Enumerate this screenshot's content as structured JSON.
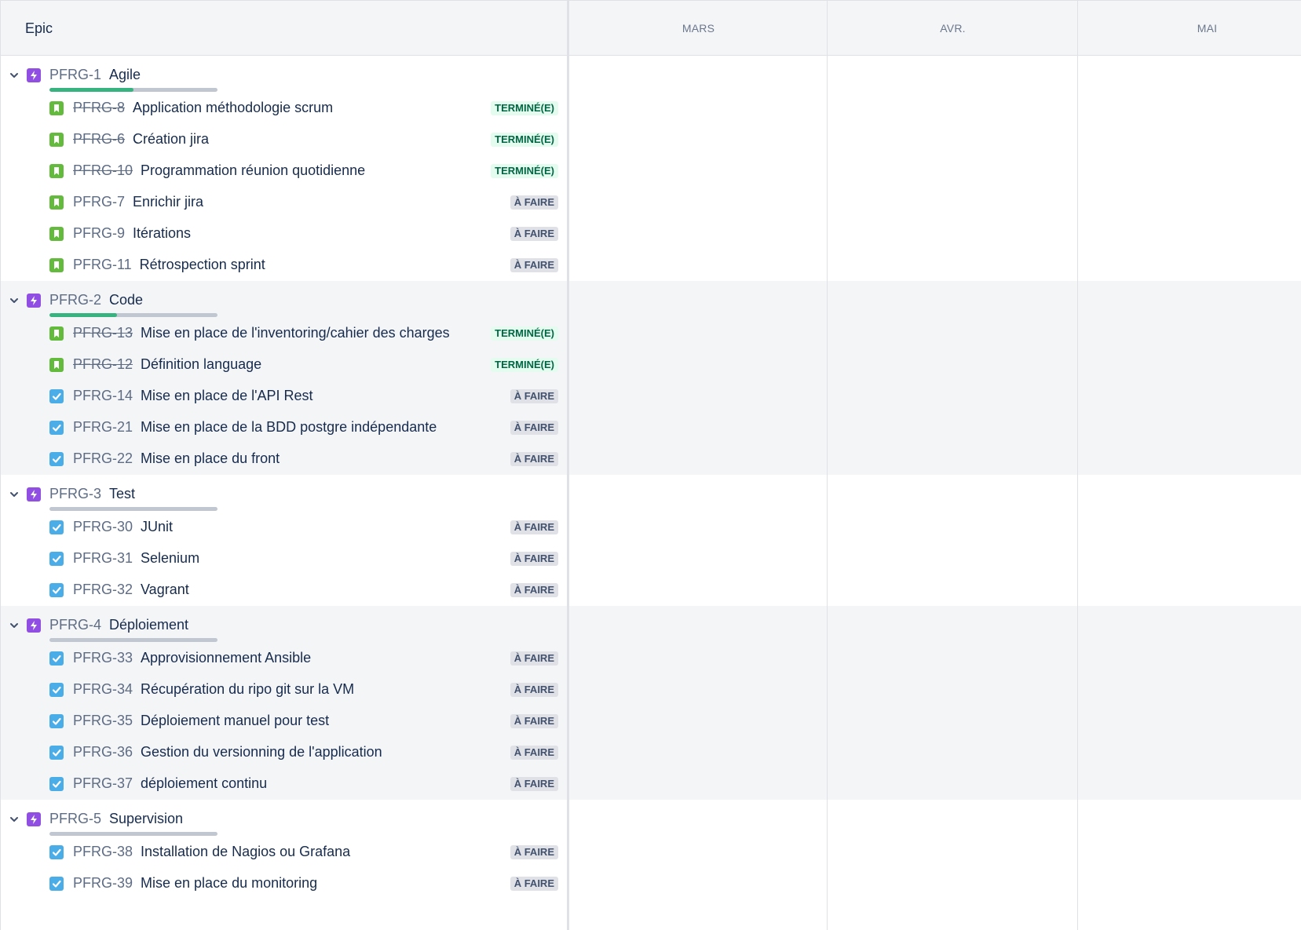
{
  "header": {
    "epic_label": "Epic",
    "months": [
      "MARS",
      "AVR.",
      "MAI"
    ]
  },
  "colors": {
    "epic_icon": "#904ee2",
    "story_icon": "#63ba3c",
    "task_icon": "#4bade8",
    "done_badge_bg": "#e3fcef",
    "done_badge_text": "#006644",
    "todo_badge_bg": "#dfe1e6",
    "todo_badge_text": "#42526e",
    "progress_done": "#36b37e"
  },
  "epics": [
    {
      "key": "PFRG-1",
      "summary": "Agile",
      "progress_done_fraction": 0.5,
      "issues": [
        {
          "key": "PFRG-8",
          "summary": "Application méthodologie scrum",
          "type": "story-icon",
          "status": "TERMINÉ(E)",
          "done": true
        },
        {
          "key": "PFRG-6",
          "summary": "Création jira",
          "type": "story-icon",
          "status": "TERMINÉ(E)",
          "done": true
        },
        {
          "key": "PFRG-10",
          "summary": "Programmation réunion quotidienne",
          "type": "story-icon",
          "status": "TERMINÉ(E)",
          "done": true
        },
        {
          "key": "PFRG-7",
          "summary": "Enrichir jira",
          "type": "story-icon",
          "status": "À FAIRE",
          "done": false
        },
        {
          "key": "PFRG-9",
          "summary": "Itérations",
          "type": "story-icon",
          "status": "À FAIRE",
          "done": false
        },
        {
          "key": "PFRG-11",
          "summary": "Rétrospection sprint",
          "type": "story-icon",
          "status": "À FAIRE",
          "done": false
        }
      ]
    },
    {
      "key": "PFRG-2",
      "summary": "Code",
      "progress_done_fraction": 0.4,
      "issues": [
        {
          "key": "PFRG-13",
          "summary": "Mise en place de l'inventoring/cahier des charges",
          "type": "story-icon",
          "status": "TERMINÉ(E)",
          "done": true
        },
        {
          "key": "PFRG-12",
          "summary": "Définition language",
          "type": "story-icon",
          "status": "TERMINÉ(E)",
          "done": true
        },
        {
          "key": "PFRG-14",
          "summary": "Mise en place de l'API Rest",
          "type": "task-icon",
          "status": "À FAIRE",
          "done": false
        },
        {
          "key": "PFRG-21",
          "summary": "Mise en place de la BDD postgre indépendante",
          "type": "task-icon",
          "status": "À FAIRE",
          "done": false
        },
        {
          "key": "PFRG-22",
          "summary": "Mise en place du front",
          "type": "task-icon",
          "status": "À FAIRE",
          "done": false
        }
      ]
    },
    {
      "key": "PFRG-3",
      "summary": "Test",
      "progress_done_fraction": 0,
      "issues": [
        {
          "key": "PFRG-30",
          "summary": "JUnit",
          "type": "task-icon",
          "status": "À FAIRE",
          "done": false
        },
        {
          "key": "PFRG-31",
          "summary": "Selenium",
          "type": "task-icon",
          "status": "À FAIRE",
          "done": false
        },
        {
          "key": "PFRG-32",
          "summary": "Vagrant",
          "type": "task-icon",
          "status": "À FAIRE",
          "done": false
        }
      ]
    },
    {
      "key": "PFRG-4",
      "summary": "Déploiement",
      "progress_done_fraction": 0,
      "issues": [
        {
          "key": "PFRG-33",
          "summary": "Approvisionnement Ansible",
          "type": "task-icon",
          "status": "À FAIRE",
          "done": false
        },
        {
          "key": "PFRG-34",
          "summary": "Récupération du ripo git sur la VM",
          "type": "task-icon",
          "status": "À FAIRE",
          "done": false
        },
        {
          "key": "PFRG-35",
          "summary": "Déploiement manuel pour test",
          "type": "task-icon",
          "status": "À FAIRE",
          "done": false
        },
        {
          "key": "PFRG-36",
          "summary": "Gestion du versionning de l'application",
          "type": "task-icon",
          "status": "À FAIRE",
          "done": false
        },
        {
          "key": "PFRG-37",
          "summary": "déploiement continu",
          "type": "task-icon",
          "status": "À FAIRE",
          "done": false
        }
      ]
    },
    {
      "key": "PFRG-5",
      "summary": "Supervision",
      "progress_done_fraction": 0,
      "issues": [
        {
          "key": "PFRG-38",
          "summary": "Installation de Nagios ou Grafana",
          "type": "task-icon",
          "status": "À FAIRE",
          "done": false
        },
        {
          "key": "PFRG-39",
          "summary": "Mise en place du monitoring",
          "type": "task-icon",
          "status": "À FAIRE",
          "done": false
        }
      ]
    }
  ]
}
